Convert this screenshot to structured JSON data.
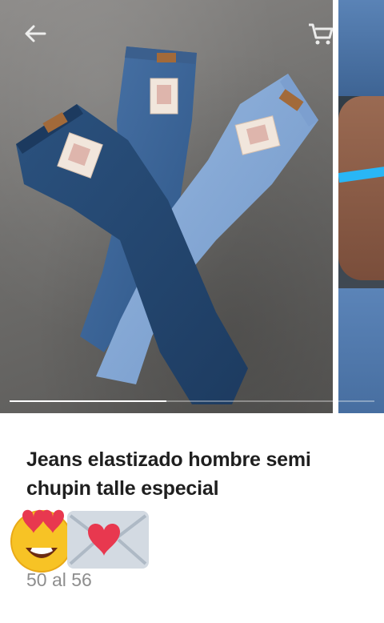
{
  "product": {
    "title": "Jeans elastizado hombre semi chupin talle especial",
    "size_range": "50 al 56"
  },
  "carousel": {
    "progress": 0.43
  },
  "icons": {
    "back": "arrow-back-icon",
    "cart": "shopping-cart-icon",
    "emoji_1": "smiling-face-with-heart-eyes-emoji",
    "emoji_2": "love-letter-emoji"
  },
  "colors": {
    "text_primary": "#1f1f1f",
    "text_secondary": "#8e8e8e",
    "denim_dark": "#23466e",
    "denim_mid": "#33609a",
    "denim_light": "#86a9d6"
  }
}
